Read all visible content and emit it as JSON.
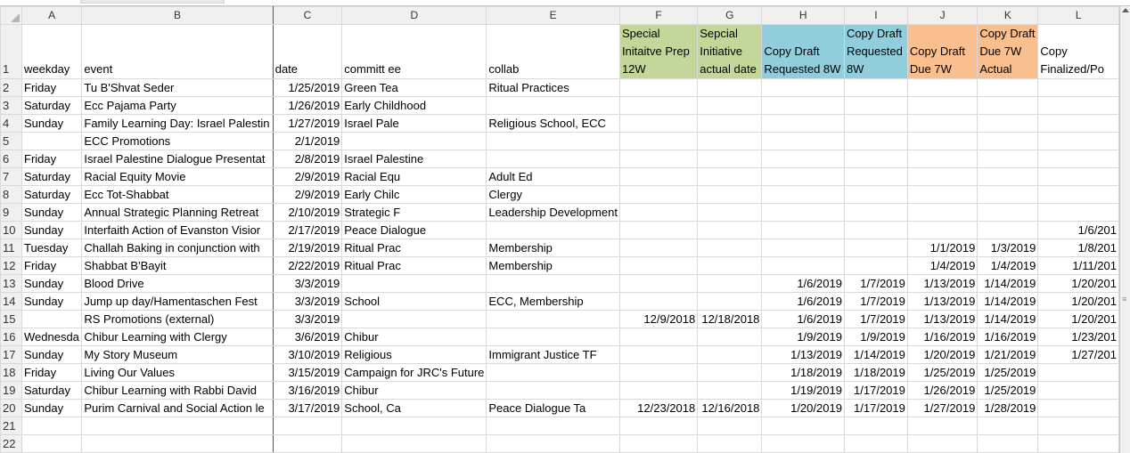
{
  "columns": [
    "A",
    "B",
    "C",
    "D",
    "E",
    "F",
    "G",
    "H",
    "I",
    "J",
    "K",
    "L"
  ],
  "header_row": {
    "num": "1",
    "cells": [
      "weekday",
      "event",
      "date",
      "committ\nee",
      "collab",
      "Special Initaitve Prep 12W",
      "Sepcial Initiative actual date",
      "Copy Draft Requested 8W",
      "Copy Draft Requested 8W",
      "Copy Draft Due 7W",
      "Copy Draft Due 7W Actual",
      "Copy Finalized/Po"
    ]
  },
  "rows": [
    {
      "num": "2",
      "cells": [
        "Friday",
        "Tu B'Shvat Seder",
        "1/25/2019",
        "Green Tea",
        "Ritual Practices",
        "",
        "",
        "",
        "",
        "",
        "",
        ""
      ]
    },
    {
      "num": "3",
      "cells": [
        "Saturday",
        "Ecc Pajama Party",
        "1/26/2019",
        "Early Childhood",
        "",
        "",
        "",
        "",
        "",
        "",
        "",
        ""
      ]
    },
    {
      "num": "4",
      "cells": [
        "Sunday",
        "Family Learning Day: Israel Palestin",
        "1/27/2019",
        "Israel Pale",
        "Religious School, ECC",
        "",
        "",
        "",
        "",
        "",
        "",
        ""
      ]
    },
    {
      "num": "5",
      "cells": [
        "",
        "ECC Promotions",
        "2/1/2019",
        "",
        "",
        "",
        "",
        "",
        "",
        "",
        "",
        ""
      ]
    },
    {
      "num": "6",
      "cells": [
        "Friday",
        "Israel Palestine Dialogue Presentat",
        "2/8/2019",
        "Israel Palestine",
        "",
        "",
        "",
        "",
        "",
        "",
        "",
        ""
      ]
    },
    {
      "num": "7",
      "cells": [
        "Saturday",
        "Racial Equity Movie",
        "2/9/2019",
        "Racial Equ",
        "Adult Ed",
        "",
        "",
        "",
        "",
        "",
        "",
        ""
      ]
    },
    {
      "num": "8",
      "cells": [
        "Saturday",
        "Ecc Tot-Shabbat",
        "2/9/2019",
        "Early Chilc",
        "Clergy",
        "",
        "",
        "",
        "",
        "",
        "",
        ""
      ]
    },
    {
      "num": "9",
      "cells": [
        "Sunday",
        "Annual Strategic Planning Retreat",
        "2/10/2019",
        "Strategic F",
        "Leadership Development",
        "",
        "",
        "",
        "",
        "",
        "",
        ""
      ]
    },
    {
      "num": "10",
      "cells": [
        "Sunday",
        "Interfaith Action of Evanston Visior",
        "2/17/2019",
        "Peace Dialogue",
        "",
        "",
        "",
        "",
        "",
        "",
        "",
        "1/6/201"
      ]
    },
    {
      "num": "11",
      "cells": [
        "Tuesday",
        "Challah Baking in conjunction with",
        "2/19/2019",
        "Ritual Prac",
        "Membership",
        "",
        "",
        "",
        "",
        "1/1/2019",
        "1/3/2019",
        "1/8/201"
      ]
    },
    {
      "num": "12",
      "cells": [
        "Friday",
        "Shabbat B'Bayit",
        "2/22/2019",
        "Ritual Prac",
        "Membership",
        "",
        "",
        "",
        "",
        "1/4/2019",
        "1/4/2019",
        "1/11/201"
      ]
    },
    {
      "num": "13",
      "cells": [
        "Sunday",
        "Blood Drive",
        "3/3/2019",
        "",
        "",
        "",
        "",
        "1/6/2019",
        "1/7/2019",
        "1/13/2019",
        "1/14/2019",
        "1/20/201"
      ]
    },
    {
      "num": "14",
      "cells": [
        "Sunday",
        "Jump up day/Hamentaschen Fest",
        "3/3/2019",
        "School",
        "ECC, Membership",
        "",
        "",
        "1/6/2019",
        "1/7/2019",
        "1/13/2019",
        "1/14/2019",
        "1/20/201"
      ]
    },
    {
      "num": "15",
      "cells": [
        "",
        "RS Promotions (external)",
        "3/3/2019",
        "",
        "",
        "12/9/2018",
        "12/18/2018",
        "1/6/2019",
        "1/7/2019",
        "1/13/2019",
        "1/14/2019",
        "1/20/201"
      ]
    },
    {
      "num": "16",
      "cells": [
        "Wednesda",
        "Chibur Learning with Clergy",
        "3/6/2019",
        "Chibur",
        "",
        "",
        "",
        "1/9/2019",
        "1/9/2019",
        "1/16/2019",
        "1/16/2019",
        "1/23/201"
      ]
    },
    {
      "num": "17",
      "cells": [
        "Sunday",
        "My Story Museum",
        "3/10/2019",
        "Religious",
        "Immigrant Justice TF",
        "",
        "",
        "1/13/2019",
        "1/14/2019",
        "1/20/2019",
        "1/21/2019",
        "1/27/201"
      ]
    },
    {
      "num": "18",
      "cells": [
        "Friday",
        "Living Our Values",
        "3/15/2019",
        "Campaign for JRC's Future",
        "",
        "",
        "",
        "1/18/2019",
        "1/18/2019",
        "1/25/2019",
        "1/25/2019",
        ""
      ]
    },
    {
      "num": "19",
      "cells": [
        "Saturday",
        "Chibur Learning with Rabbi David",
        "3/16/2019",
        "Chibur",
        "",
        "",
        "",
        "1/19/2019",
        "1/17/2019",
        "1/26/2019",
        "1/25/2019",
        ""
      ]
    },
    {
      "num": "20",
      "cells": [
        "Sunday",
        "Purim Carnival and Social Action le",
        "3/17/2019",
        "School, Ca",
        "Peace Dialogue Ta",
        "12/23/2018",
        "12/16/2018",
        "1/20/2019",
        "1/17/2019",
        "1/27/2019",
        "1/28/2019",
        ""
      ]
    },
    {
      "num": "21",
      "cells": [
        "",
        "",
        "",
        "",
        "",
        "",
        "",
        "",
        "",
        "",
        "",
        ""
      ]
    },
    {
      "num": "22",
      "cells": [
        "",
        "",
        "",
        "",
        "",
        "",
        "",
        "",
        "",
        "",
        "",
        ""
      ]
    }
  ],
  "header_colors": {
    "green": "#c4d79b",
    "blue": "#92cddc",
    "orange": "#fabf8f"
  },
  "icons": {
    "corner": "select-all-triangle",
    "scroll_up": "scroll-up-arrow"
  }
}
